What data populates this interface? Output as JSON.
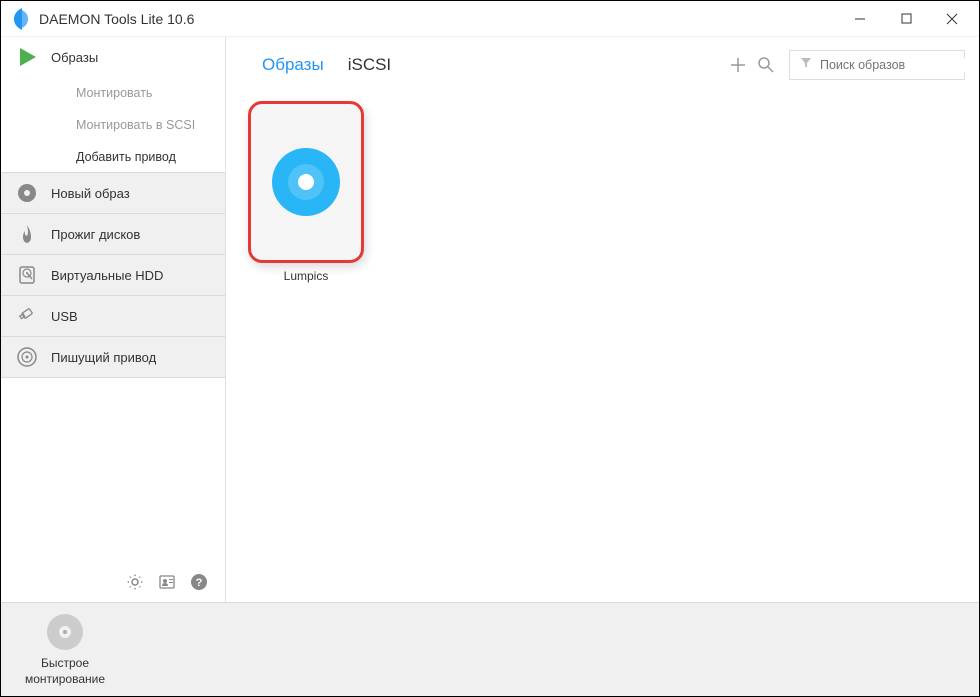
{
  "window": {
    "title": "DAEMON Tools Lite 10.6"
  },
  "sidebar": {
    "images": {
      "label": "Образы"
    },
    "mount": {
      "label": "Монтировать"
    },
    "mount_scsi": {
      "label": "Монтировать в SCSI"
    },
    "add_drive": {
      "label": "Добавить привод"
    },
    "new_image": {
      "label": "Новый образ"
    },
    "burn": {
      "label": "Прожиг дисков"
    },
    "vhdd": {
      "label": "Виртуальные HDD"
    },
    "usb": {
      "label": "USB"
    },
    "writable": {
      "label": "Пишущий привод"
    }
  },
  "tabs": {
    "images": "Образы",
    "iscsi": "iSCSI"
  },
  "search": {
    "placeholder": "Поиск образов"
  },
  "images_list": {
    "item0": {
      "label": "Lumpics"
    }
  },
  "quick_mount": {
    "label": "Быстрое\nмонтирование"
  }
}
